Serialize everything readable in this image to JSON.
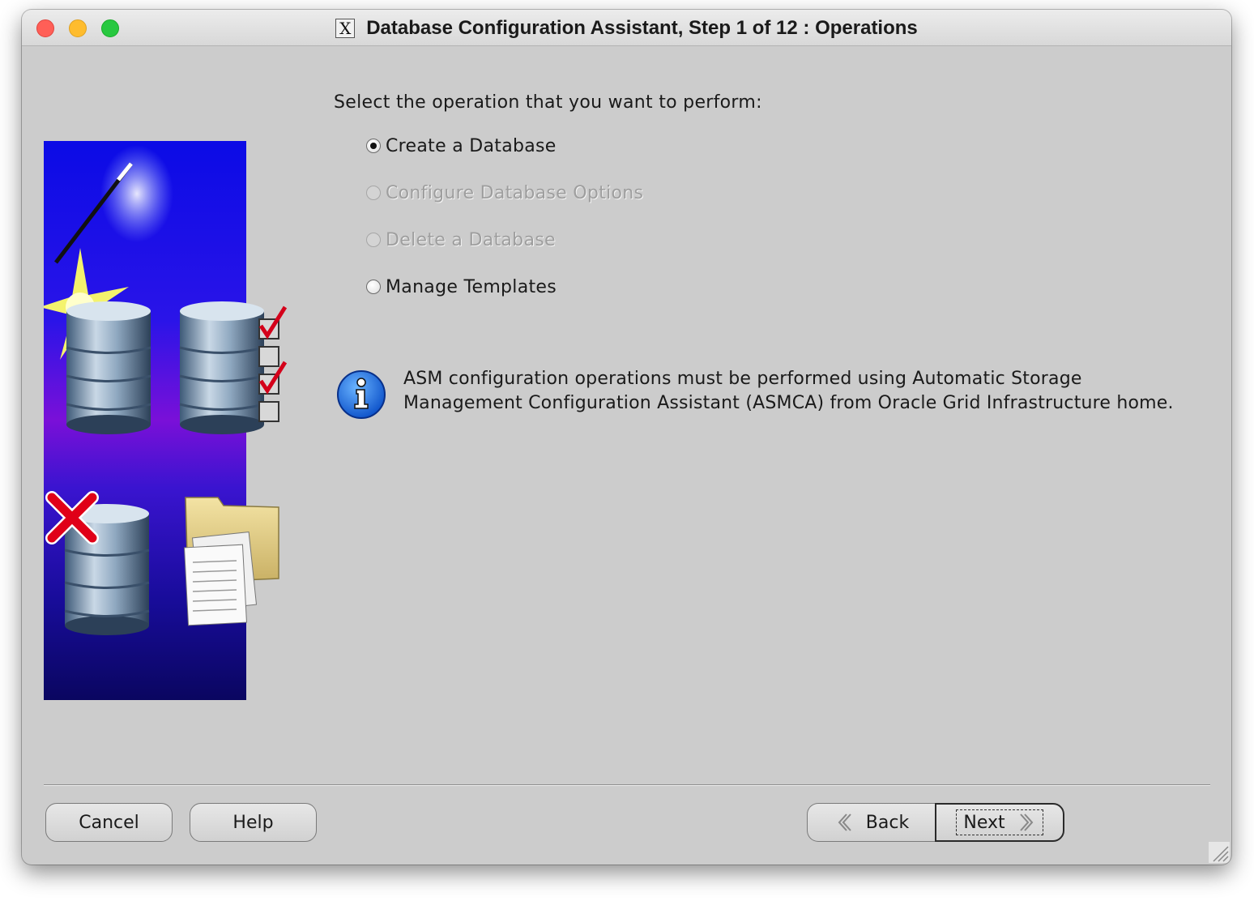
{
  "window": {
    "title": "Database Configuration Assistant, Step 1 of 12 : Operations"
  },
  "content": {
    "prompt": "Select the operation that you want to perform:",
    "operations": [
      {
        "label": "Create a Database",
        "selected": true,
        "enabled": true
      },
      {
        "label": "Configure Database Options",
        "selected": false,
        "enabled": false
      },
      {
        "label": "Delete a Database",
        "selected": false,
        "enabled": false
      },
      {
        "label": "Manage Templates",
        "selected": false,
        "enabled": true
      }
    ],
    "info": {
      "icon": "info-icon",
      "line1": "ASM configuration operations must be performed using Automatic Storage",
      "line2": "Management Configuration Assistant (ASMCA) from Oracle Grid Infrastructure home."
    }
  },
  "buttons": {
    "cancel": "Cancel",
    "help": "Help",
    "back": "Back",
    "next": "Next"
  },
  "colors": {
    "window_bg": "#cccccc",
    "illustration_top": "#0a0ae0",
    "illustration_mid": "#7a10d8",
    "illustration_bottom": "#0a0660",
    "checkmark": "#d4001a"
  }
}
